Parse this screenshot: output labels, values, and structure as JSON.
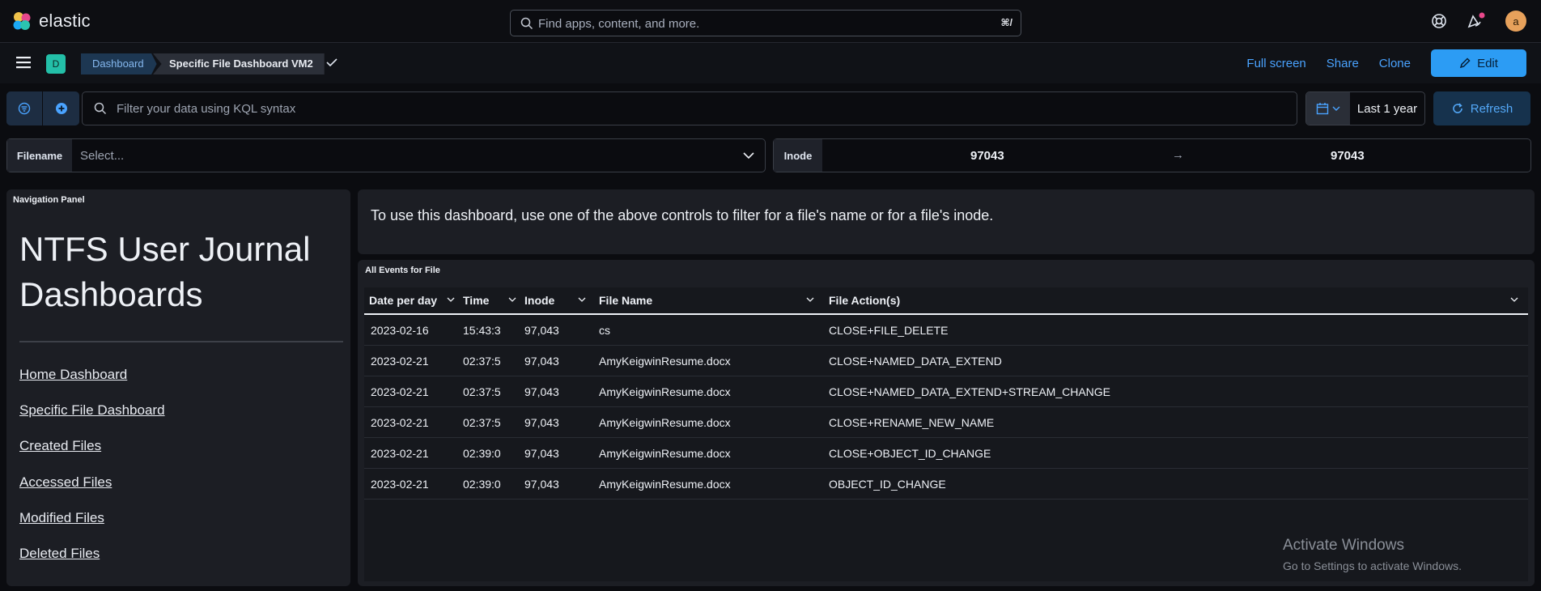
{
  "header": {
    "brand": "elastic",
    "search_placeholder": "Find apps, content, and more.",
    "search_shortcut": "⌘/",
    "avatar_initial": "a"
  },
  "breadcrumbs": {
    "space_badge": "D",
    "items": [
      "Dashboard",
      "Specific File Dashboard VM2"
    ]
  },
  "actions": {
    "full_screen": "Full screen",
    "share": "Share",
    "clone": "Clone",
    "edit": "Edit"
  },
  "query_bar": {
    "placeholder": "Filter your data using KQL syntax",
    "time_range": "Last 1 year",
    "refresh": "Refresh"
  },
  "controls": {
    "filename_label": "Filename",
    "filename_value": "Select...",
    "inode_label": "Inode",
    "inode_from": "97043",
    "inode_arrow": "→",
    "inode_to": "97043"
  },
  "nav_panel": {
    "title": "Navigation Panel",
    "heading": "NTFS User Journal Dashboards",
    "links": [
      "Home Dashboard",
      "Specific File Dashboard",
      "Created Files",
      "Accessed Files",
      "Modified Files",
      "Deleted Files"
    ]
  },
  "info_panel": {
    "text": "To use this dashboard, use one of the above controls to filter for a file's name or for a file's inode."
  },
  "events_panel": {
    "title": "All Events for File",
    "columns": [
      "Date per day",
      "Time",
      "Inode",
      "File Name",
      "File Action(s)"
    ],
    "rows": [
      [
        "2023-02-16",
        "15:43:3",
        "97,043",
        "cs",
        "CLOSE+FILE_DELETE"
      ],
      [
        "2023-02-21",
        "02:37:5",
        "97,043",
        "AmyKeigwinResume.docx",
        "CLOSE+NAMED_DATA_EXTEND"
      ],
      [
        "2023-02-21",
        "02:37:5",
        "97,043",
        "AmyKeigwinResume.docx",
        "CLOSE+NAMED_DATA_EXTEND+STREAM_CHANGE"
      ],
      [
        "2023-02-21",
        "02:37:5",
        "97,043",
        "AmyKeigwinResume.docx",
        "CLOSE+RENAME_NEW_NAME"
      ],
      [
        "2023-02-21",
        "02:39:0",
        "97,043",
        "AmyKeigwinResume.docx",
        "CLOSE+OBJECT_ID_CHANGE"
      ],
      [
        "2023-02-21",
        "02:39:0",
        "97,043",
        "AmyKeigwinResume.docx",
        "OBJECT_ID_CHANGE"
      ]
    ]
  },
  "watermark": {
    "line1": "Activate Windows",
    "line2": "Go to Settings to activate Windows."
  },
  "colors": {
    "accent": "#2c9cf4",
    "link": "#4aa3ff",
    "space_badge": "#23bfa8",
    "avatar": "#e7a15b",
    "panel_bg": "#1c1e24"
  }
}
